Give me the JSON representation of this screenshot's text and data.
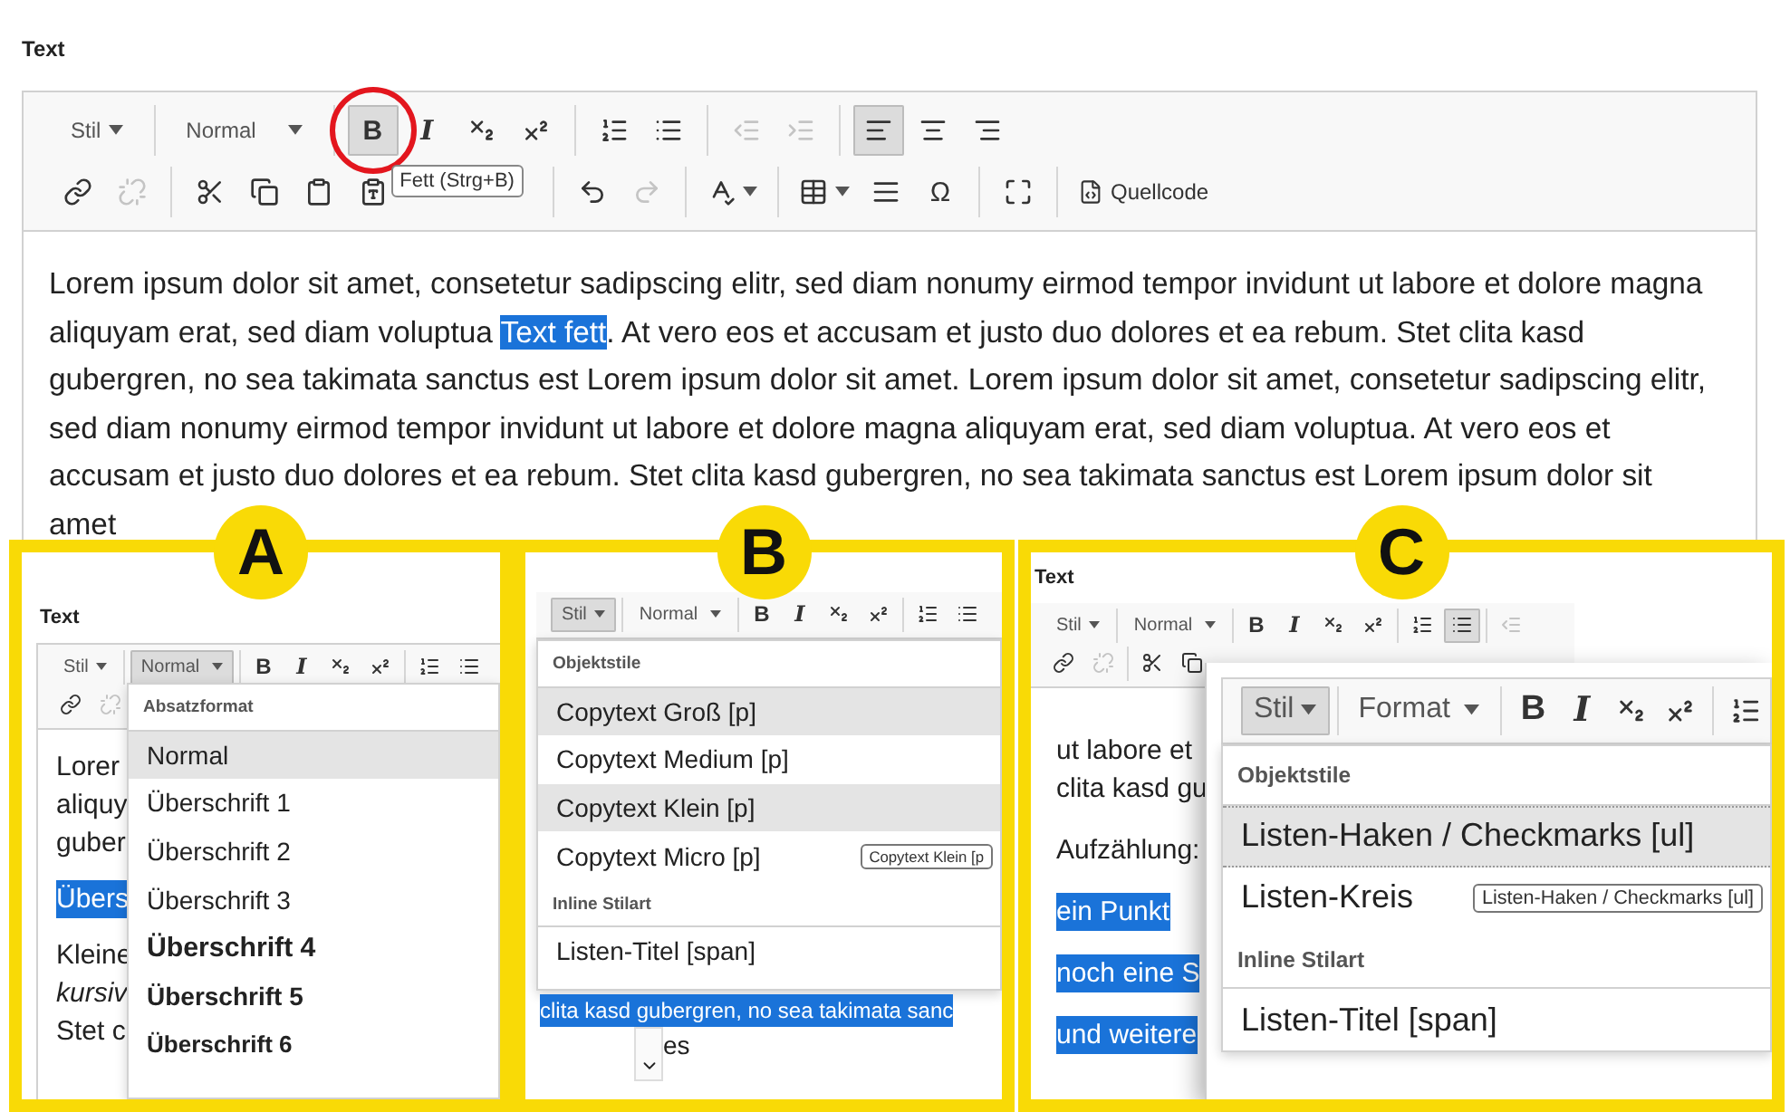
{
  "section_title": "Text",
  "editor": {
    "toolbar": [
      [
        [
          {
            "kind": "dropdown",
            "label": "Stil",
            "pressed": false,
            "disabled": false
          }
        ],
        [
          {
            "kind": "dropdown",
            "label": "Normal",
            "pressed": false,
            "disabled": false
          }
        ],
        [
          {
            "kind": "bold",
            "label": "B",
            "pressed": true,
            "disabled": false,
            "circled": true,
            "tooltip": "Fett (Strg+B)"
          },
          {
            "kind": "italic",
            "label": "I",
            "pressed": false,
            "disabled": false
          },
          {
            "kind": "subscript",
            "pressed": false,
            "disabled": false
          },
          {
            "kind": "superscript",
            "pressed": false,
            "disabled": false
          }
        ],
        [
          {
            "kind": "numbered-list",
            "pressed": false,
            "disabled": false
          },
          {
            "kind": "bulleted-list",
            "pressed": false,
            "disabled": false
          }
        ],
        [
          {
            "kind": "outdent",
            "pressed": false,
            "disabled": true
          },
          {
            "kind": "indent",
            "pressed": false,
            "disabled": true
          }
        ],
        [
          {
            "kind": "align-left",
            "pressed": true,
            "disabled": false
          },
          {
            "kind": "align-center",
            "pressed": false,
            "disabled": false
          },
          {
            "kind": "align-right",
            "pressed": false,
            "disabled": false
          }
        ]
      ],
      [
        [
          {
            "kind": "link",
            "pressed": false,
            "disabled": false
          },
          {
            "kind": "unlink",
            "pressed": false,
            "disabled": true
          }
        ],
        [
          {
            "kind": "cut",
            "pressed": false,
            "disabled": false
          },
          {
            "kind": "copy",
            "pressed": false,
            "disabled": false
          },
          {
            "kind": "paste",
            "pressed": false,
            "disabled": false
          },
          {
            "kind": "paste-text",
            "pressed": false,
            "disabled": false
          }
        ],
        [
          {
            "kind": "undo",
            "pressed": false,
            "disabled": false
          },
          {
            "kind": "redo",
            "pressed": false,
            "disabled": true
          }
        ],
        [
          {
            "kind": "spellcheck",
            "pressed": false,
            "disabled": false
          }
        ],
        [
          {
            "kind": "table",
            "pressed": false,
            "disabled": false
          },
          {
            "kind": "rule",
            "pressed": false,
            "disabled": false
          },
          {
            "kind": "symbol",
            "label": "Ω",
            "pressed": false,
            "disabled": false
          }
        ],
        [
          {
            "kind": "maximize",
            "pressed": false,
            "disabled": false
          }
        ],
        [
          {
            "kind": "source",
            "label": "Quellcode",
            "pressed": false,
            "disabled": false
          }
        ]
      ]
    ],
    "paragraph": [
      {
        "text": "Lorem ipsum dolor sit amet, consetetur sadipscing elitr, sed diam nonumy eirmod tempor invidunt ut labore et dolore magna aliquyam erat, sed diam voluptua ",
        "selected": false
      },
      {
        "text": "Text fett",
        "selected": true
      },
      {
        "text": ". At vero eos et accusam et justo duo dolores et ea rebum. Stet clita kasd gubergren, no sea takimata sanctus est Lorem ipsum dolor sit amet. Lorem ipsum dolor sit amet, consetetur sadipscing elitr, sed diam nonumy eirmod tempor invidunt ut labore et dolore magna aliquyam erat, sed diam voluptua. At vero eos et accusam et justo duo dolores et ea rebum. Stet clita kasd gubergren, no sea takimata sanctus est Lorem ipsum dolor sit amet",
        "selected": false
      }
    ]
  },
  "panels": [
    {
      "kind": "dropdown-left",
      "badge": "A",
      "heading": "Text",
      "toolbar": [
        [
          [
            {
              "kind": "dropdown",
              "label": "Stil",
              "pressed": false,
              "disabled": false
            }
          ],
          [
            {
              "kind": "dropdown",
              "label": "Normal",
              "pressed": true,
              "disabled": false
            }
          ],
          [
            {
              "kind": "bold",
              "label": "B",
              "pressed": false,
              "disabled": false
            },
            {
              "kind": "italic",
              "label": "I",
              "pressed": false,
              "disabled": false
            },
            {
              "kind": "subscript",
              "pressed": false,
              "disabled": false
            },
            {
              "kind": "superscript",
              "pressed": false,
              "disabled": false
            }
          ],
          [
            {
              "kind": "numbered-list",
              "pressed": false,
              "disabled": false
            },
            {
              "kind": "bulleted-list",
              "pressed": false,
              "disabled": false
            }
          ]
        ],
        [
          [
            {
              "kind": "link",
              "pressed": false,
              "disabled": false
            },
            {
              "kind": "unlink",
              "pressed": false,
              "disabled": true
            }
          ]
        ]
      ],
      "body": [
        [
          {
            "text": "Lorer",
            "kind": "plain"
          },
          {
            "text": "aliquy",
            "kind": "plain"
          },
          {
            "text": "guber",
            "kind": "plain"
          }
        ],
        [
          {
            "text": "Übers",
            "kind": "selected"
          }
        ],
        [
          {
            "text": "Kleine",
            "kind": "plain"
          },
          {
            "text": "kursiv",
            "kind": "italic"
          },
          {
            "text": "Stet c",
            "kind": "plain"
          }
        ]
      ],
      "menu": {
        "sections": [
          {
            "header": "Absatzformat",
            "items": [
              {
                "label": "Normal",
                "kind": "plain",
                "selected": true
              },
              {
                "label": "Überschrift 1",
                "kind": "plain",
                "selected": false
              },
              {
                "label": "Überschrift 2",
                "kind": "plain",
                "selected": false
              },
              {
                "label": "Überschrift 3",
                "kind": "plain",
                "selected": false
              },
              {
                "label": "Überschrift 4",
                "kind": "h4",
                "selected": false
              },
              {
                "label": "Überschrift 5",
                "kind": "h5",
                "selected": false
              },
              {
                "label": "Überschrift 6",
                "kind": "h6",
                "selected": false
              }
            ]
          }
        ]
      }
    },
    {
      "kind": "dropdown-full",
      "badge": "B",
      "toolbar": [
        [
          [
            {
              "kind": "dropdown",
              "label": "Stil",
              "pressed": true,
              "disabled": false
            }
          ],
          [
            {
              "kind": "dropdown",
              "label": "Normal",
              "pressed": false,
              "disabled": false
            }
          ],
          [
            {
              "kind": "bold",
              "label": "B",
              "pressed": false,
              "disabled": false
            },
            {
              "kind": "italic",
              "label": "I",
              "pressed": false,
              "disabled": false
            },
            {
              "kind": "subscript",
              "pressed": false,
              "disabled": false
            },
            {
              "kind": "superscript",
              "pressed": false,
              "disabled": false
            }
          ],
          [
            {
              "kind": "numbered-list",
              "pressed": false,
              "disabled": false
            },
            {
              "kind": "bulleted-list",
              "pressed": false,
              "disabled": false
            }
          ]
        ]
      ],
      "menu": {
        "sections": [
          {
            "header": "Objektstile",
            "items": [
              {
                "label": "Copytext Groß [p]",
                "kind": "plain",
                "selected": true
              },
              {
                "label": "Copytext Medium [p]",
                "kind": "plain",
                "selected": false
              },
              {
                "label": "Copytext Klein [p]",
                "kind": "plain",
                "selected": true
              },
              {
                "label": "Copytext Micro [p]",
                "kind": "plain",
                "selected": false,
                "tooltip": "Copytext Klein [p"
              }
            ]
          },
          {
            "header": "Inline Stilart",
            "items": [
              {
                "label": "Listen-Titel [span]",
                "kind": "plain",
                "selected": false
              }
            ]
          }
        ]
      },
      "body": [
        [
          {
            "text": "clita kasd gubergren, no sea takimata sanc",
            "kind": "selected"
          },
          {
            "text": "es",
            "kind": "scrolled"
          }
        ]
      ]
    },
    {
      "kind": "popup",
      "badge": "C",
      "heading": "Text",
      "toolbar": [
        [
          [
            {
              "kind": "dropdown",
              "label": "Stil",
              "pressed": false,
              "disabled": false
            }
          ],
          [
            {
              "kind": "dropdown",
              "label": "Normal",
              "pressed": false,
              "disabled": false
            }
          ],
          [
            {
              "kind": "bold",
              "label": "B",
              "pressed": false,
              "disabled": false
            },
            {
              "kind": "italic",
              "label": "I",
              "pressed": false,
              "disabled": false
            },
            {
              "kind": "subscript",
              "pressed": false,
              "disabled": false
            },
            {
              "kind": "superscript",
              "pressed": false,
              "disabled": false
            }
          ],
          [
            {
              "kind": "numbered-list",
              "pressed": false,
              "disabled": false
            },
            {
              "kind": "bulleted-list",
              "pressed": true,
              "disabled": false
            }
          ],
          [
            {
              "kind": "outdent",
              "pressed": false,
              "disabled": true
            }
          ]
        ],
        [
          [
            {
              "kind": "link",
              "pressed": false,
              "disabled": false
            },
            {
              "kind": "unlink",
              "pressed": false,
              "disabled": true
            }
          ],
          [
            {
              "kind": "cut",
              "pressed": false,
              "disabled": false
            },
            {
              "kind": "copy",
              "pressed": false,
              "disabled": false
            }
          ]
        ]
      ],
      "body": [
        [
          {
            "text": "ut labore et",
            "kind": "plain"
          },
          {
            "text": "clita kasd gu",
            "kind": "plain"
          }
        ],
        [
          {
            "text": "Aufzählung:",
            "kind": "plain"
          }
        ],
        [
          {
            "text": "ein Punkt",
            "kind": "selected"
          }
        ],
        [
          {
            "text": "noch eine S",
            "kind": "selected"
          }
        ],
        [
          {
            "text": "und weitere",
            "kind": "selected"
          }
        ]
      ],
      "popup": {
        "toolbar": [
          [
            [
              {
                "kind": "dropdown",
                "label": "Stil",
                "pressed": true,
                "disabled": false
              }
            ],
            [
              {
                "kind": "dropdown",
                "label": "Format",
                "pressed": false,
                "disabled": false
              }
            ],
            [
              {
                "kind": "bold",
                "label": "B",
                "pressed": false,
                "disabled": false
              },
              {
                "kind": "italic",
                "label": "I",
                "pressed": false,
                "disabled": false
              },
              {
                "kind": "subscript",
                "pressed": false,
                "disabled": false
              },
              {
                "kind": "superscript",
                "pressed": false,
                "disabled": false
              }
            ],
            [
              {
                "kind": "numbered-list",
                "pressed": false,
                "disabled": false
              }
            ]
          ]
        ],
        "menu": {
          "sections": [
            {
              "header": "Objektstile",
              "items": [
                {
                  "label": "Listen-Haken / Checkmarks [ul]",
                  "kind": "plain",
                  "selected": true
                },
                {
                  "label": "Listen-Kreis",
                  "kind": "plain",
                  "selected": false,
                  "tooltip": "Listen-Haken / Checkmarks [ul]"
                }
              ]
            },
            {
              "header": "Inline Stilart",
              "items": [
                {
                  "label": "Listen-Titel [span]",
                  "kind": "plain",
                  "selected": false
                }
              ]
            }
          ]
        }
      }
    }
  ]
}
